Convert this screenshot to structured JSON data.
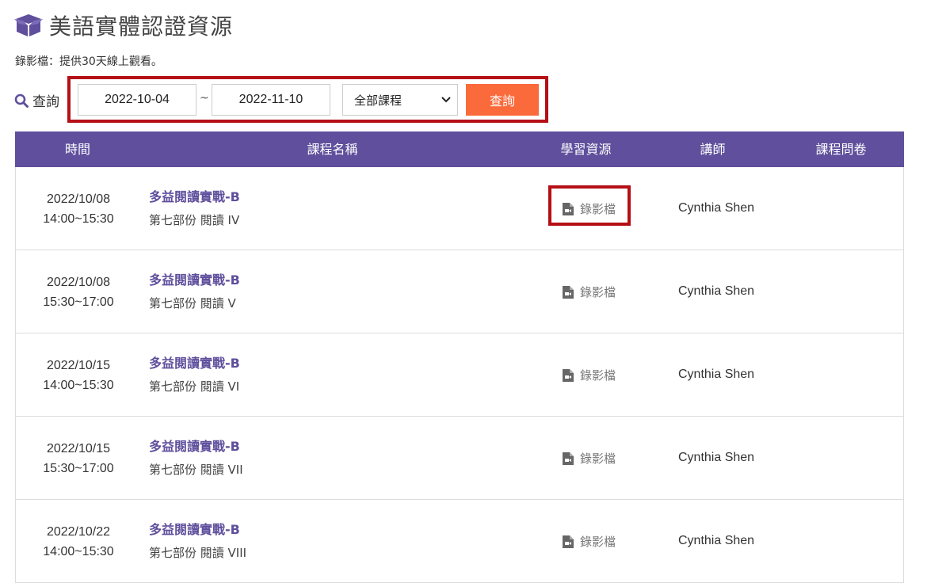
{
  "header": {
    "title": "美語實體認證資源",
    "icon": "box-icon"
  },
  "note": "錄影檔：提供30天線上觀看。",
  "filter": {
    "label": "查詢",
    "date_start": "2022-10-04",
    "separator": "~",
    "date_end": "2022-11-10",
    "course_select": "全部課程",
    "button": "查詢"
  },
  "table": {
    "headers": [
      "時間",
      "課程名稱",
      "學習資源",
      "講師",
      "課程問卷"
    ],
    "rows": [
      {
        "date": "2022/10/08",
        "time": "14:00~15:30",
        "course": "多益閱讀實戰-B",
        "section": "第七部份 閱讀 IV",
        "resource": "錄影檔",
        "teacher": "Cynthia Shen",
        "survey": ""
      },
      {
        "date": "2022/10/08",
        "time": "15:30~17:00",
        "course": "多益閱讀實戰-B",
        "section": "第七部份 閱讀 V",
        "resource": "錄影檔",
        "teacher": "Cynthia Shen",
        "survey": ""
      },
      {
        "date": "2022/10/15",
        "time": "14:00~15:30",
        "course": "多益閱讀實戰-B",
        "section": "第七部份 閱讀 VI",
        "resource": "錄影檔",
        "teacher": "Cynthia Shen",
        "survey": ""
      },
      {
        "date": "2022/10/15",
        "time": "15:30~17:00",
        "course": "多益閱讀實戰-B",
        "section": "第七部份 閱讀 VII",
        "resource": "錄影檔",
        "teacher": "Cynthia Shen",
        "survey": ""
      },
      {
        "date": "2022/10/22",
        "time": "14:00~15:30",
        "course": "多益閱讀實戰-B",
        "section": "第七部份 閱讀 VIII",
        "resource": "錄影檔",
        "teacher": "Cynthia Shen",
        "survey": ""
      }
    ]
  },
  "colors": {
    "accent": "#5f4f9c",
    "button": "#fb6a3a",
    "highlight": "#b50f16"
  }
}
